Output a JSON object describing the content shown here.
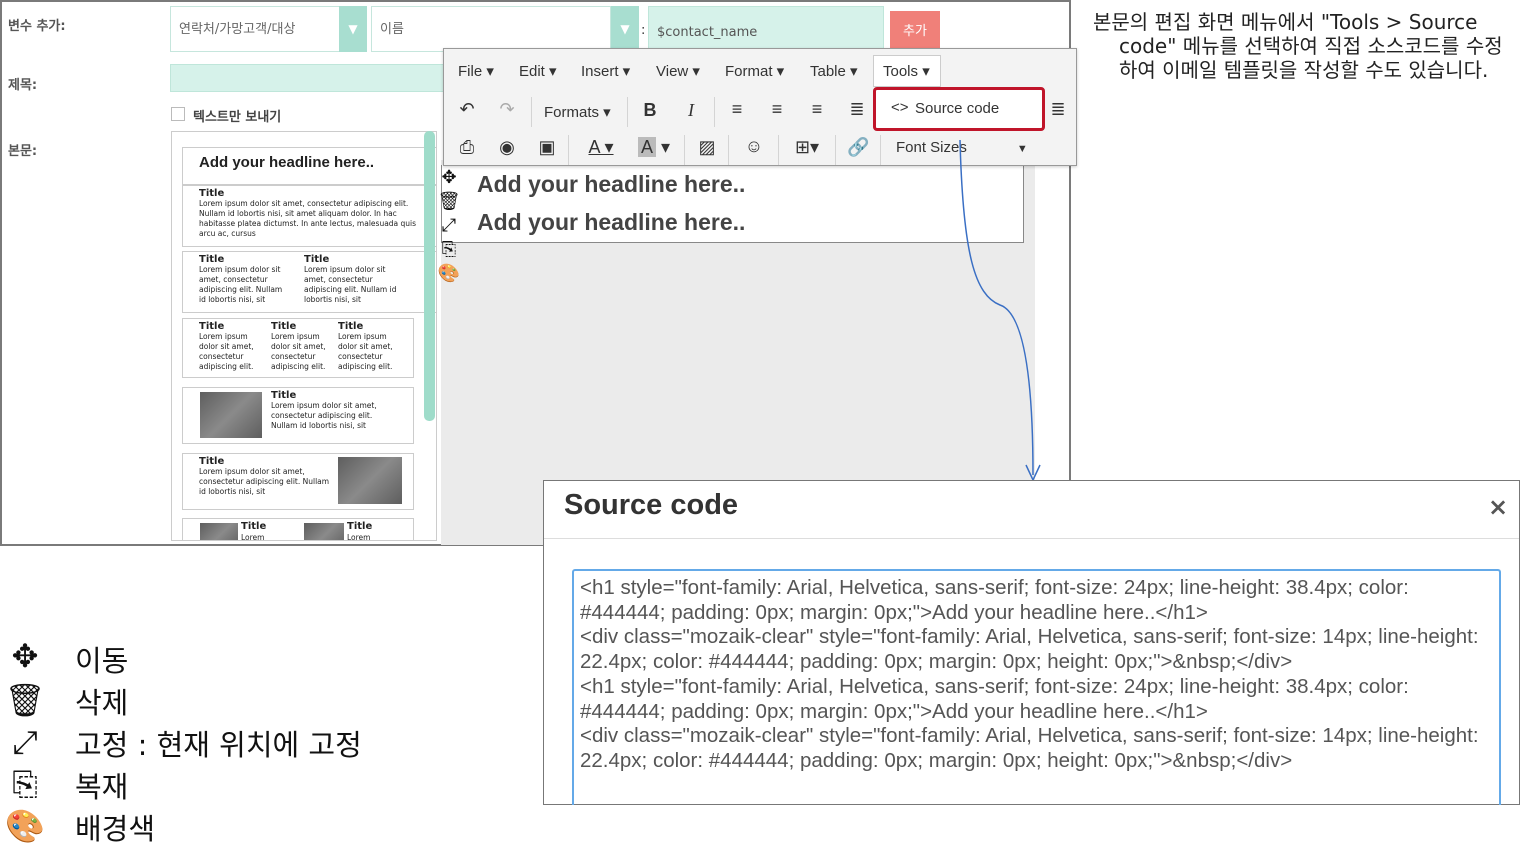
{
  "form": {
    "var_add_label": "변수 추가:",
    "var_select": "연락처/가망고객/대상",
    "field_select": "이름",
    "colon": ":",
    "var_value": "$contact_name",
    "add_button": "추가",
    "subject_label": "제목:",
    "text_only_label": "텍스트만 보내기",
    "body_label": "본문:"
  },
  "palette": {
    "headline": "Add your headline here..",
    "title": "Title",
    "lorem_long": "Lorem ipsum dolor sit amet, consectetur adipiscing elit. Nullam id lobortis nisi, sit amet aliquam dolor. In hac habitasse platea dictumst. In ante lectus, malesuada quis arcu ac, cursus",
    "lorem_2col": "Lorem ipsum dolor sit amet, consectetur adipiscing elit. Nullam id lobortis nisi, sit",
    "lorem_3col": "Lorem ipsum dolor sit amet, consectetur adipiscing elit.",
    "lorem_img": "Lorem ipsum dolor sit amet, consectetur adipiscing elit. Nullam id lobortis nisi, sit",
    "lorem_short": "Lorem"
  },
  "toolbar": {
    "menus": [
      "File",
      "Edit",
      "Insert",
      "View",
      "Format",
      "Table",
      "Tools"
    ],
    "formats": "Formats",
    "font_sizes": "Font Sizes",
    "source_code_item": "Source code",
    "source_code_glyph": "<>"
  },
  "editor": {
    "headline_1": "Add your headline here..",
    "headline_2": "Add your headline here.."
  },
  "annotation": "본문의 편집 화면 메뉴에서 \"Tools > Source code\" 메뉴를 선택하여 직접 소스코드를 수정하여 이메일 템플릿을 작성할 수도 있습니다.",
  "dialog": {
    "title": "Source code",
    "close": "×",
    "code": "<h1 style=\"font-family: Arial, Helvetica, sans-serif; font-size: 24px; line-height: 38.4px; color: #444444; padding: 0px; margin: 0px;\">Add your headline here..</h1>\n<div class=\"mozaik-clear\" style=\"font-family: Arial, Helvetica, sans-serif; font-size: 14px; line-height: 22.4px; color: #444444; padding: 0px; margin: 0px; height: 0px;\">&nbsp;</div>\n<h1 style=\"font-family: Arial, Helvetica, sans-serif; font-size: 24px; line-height: 38.4px; color: #444444; padding: 0px; margin: 0px;\">Add your headline here..</h1>\n<div class=\"mozaik-clear\" style=\"font-family: Arial, Helvetica, sans-serif; font-size: 14px; line-height: 22.4px; color: #444444; padding: 0px; margin: 0px; height: 0px;\">&nbsp;</div>"
  },
  "legend": {
    "move": "이동",
    "delete": "삭제",
    "pin": "고정 : 현재 위치에 고정",
    "duplicate": "복재",
    "background": "배경색"
  },
  "colors": {
    "accent_mint": "#a8ded0",
    "add_red": "#f08079",
    "highlight_red": "#c0152a",
    "focus_blue": "#64a9e8"
  }
}
